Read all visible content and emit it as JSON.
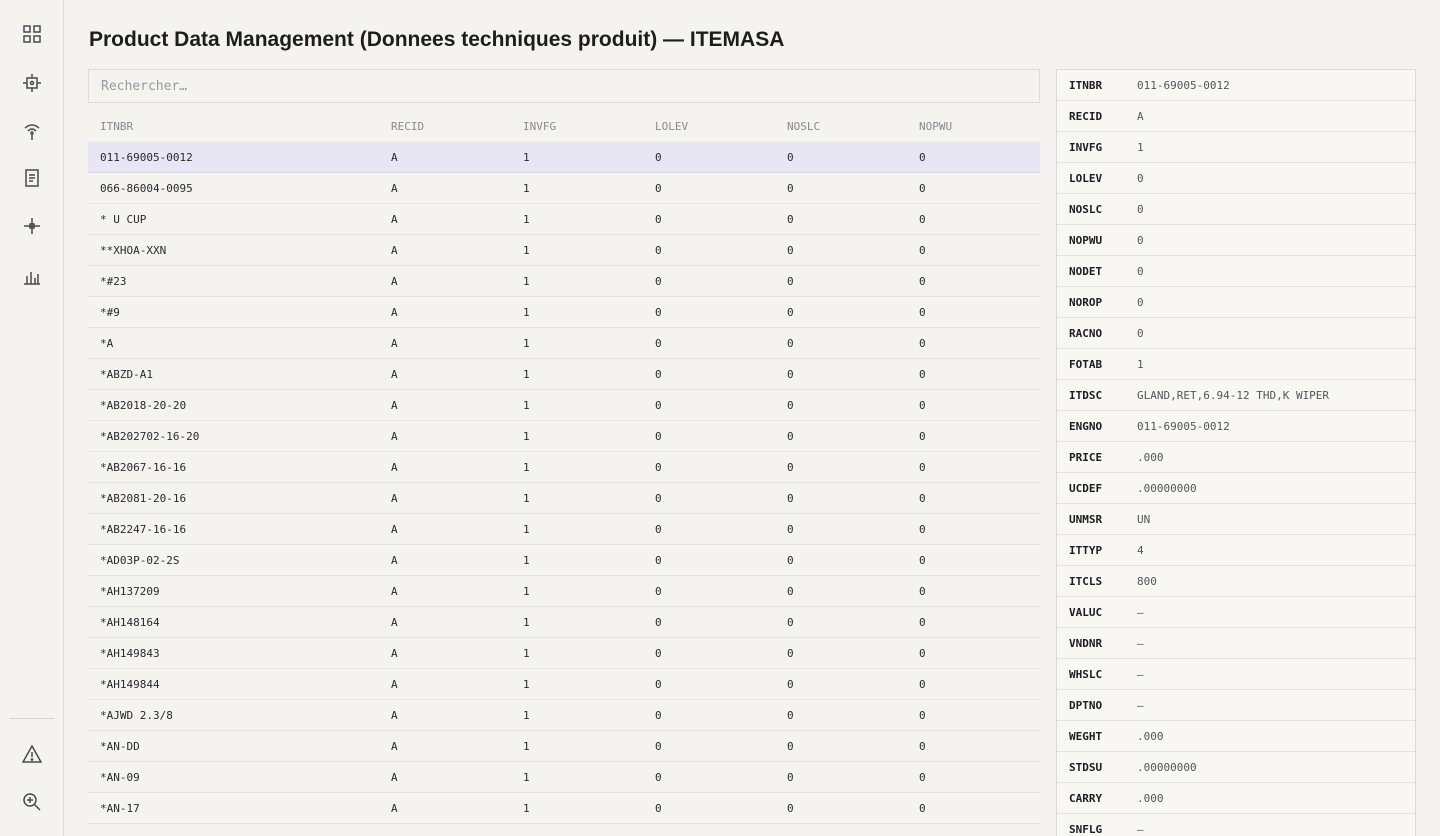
{
  "page": {
    "title": "Product Data Management (Donnees techniques produit) — ITEMASA"
  },
  "search": {
    "placeholder": "Rechercher…"
  },
  "sidebar": {
    "icons": [
      "grid-icon",
      "chip-icon",
      "antenna-icon",
      "document-icon",
      "crosshair-icon",
      "bar-chart-icon",
      "warning-icon",
      "zoom-icon"
    ]
  },
  "table": {
    "columns": [
      "ITNBR",
      "RECID",
      "INVFG",
      "LOLEV",
      "NOSLC",
      "NOPWU"
    ],
    "rows": [
      [
        "011-69005-0012",
        "A",
        "1",
        "0",
        "0",
        "0"
      ],
      [
        "066-86004-0095",
        "A",
        "1",
        "0",
        "0",
        "0"
      ],
      [
        "* U CUP",
        "A",
        "1",
        "0",
        "0",
        "0"
      ],
      [
        "**XHOA-XXN",
        "A",
        "1",
        "0",
        "0",
        "0"
      ],
      [
        "*#23",
        "A",
        "1",
        "0",
        "0",
        "0"
      ],
      [
        "*#9",
        "A",
        "1",
        "0",
        "0",
        "0"
      ],
      [
        "*A",
        "A",
        "1",
        "0",
        "0",
        "0"
      ],
      [
        "*ABZD-A1",
        "A",
        "1",
        "0",
        "0",
        "0"
      ],
      [
        "*AB2018-20-20",
        "A",
        "1",
        "0",
        "0",
        "0"
      ],
      [
        "*AB202702-16-20",
        "A",
        "1",
        "0",
        "0",
        "0"
      ],
      [
        "*AB2067-16-16",
        "A",
        "1",
        "0",
        "0",
        "0"
      ],
      [
        "*AB2081-20-16",
        "A",
        "1",
        "0",
        "0",
        "0"
      ],
      [
        "*AB2247-16-16",
        "A",
        "1",
        "0",
        "0",
        "0"
      ],
      [
        "*AD03P-02-2S",
        "A",
        "1",
        "0",
        "0",
        "0"
      ],
      [
        "*AH137209",
        "A",
        "1",
        "0",
        "0",
        "0"
      ],
      [
        "*AH148164",
        "A",
        "1",
        "0",
        "0",
        "0"
      ],
      [
        "*AH149843",
        "A",
        "1",
        "0",
        "0",
        "0"
      ],
      [
        "*AH149844",
        "A",
        "1",
        "0",
        "0",
        "0"
      ],
      [
        "*AJWD 2.3/8",
        "A",
        "1",
        "0",
        "0",
        "0"
      ],
      [
        "*AN-DD",
        "A",
        "1",
        "0",
        "0",
        "0"
      ],
      [
        "*AN-09",
        "A",
        "1",
        "0",
        "0",
        "0"
      ],
      [
        "*AN-17",
        "A",
        "1",
        "0",
        "0",
        "0"
      ]
    ]
  },
  "detail": {
    "fields": [
      [
        "ITNBR",
        "011-69005-0012"
      ],
      [
        "RECID",
        "A"
      ],
      [
        "INVFG",
        "1"
      ],
      [
        "LOLEV",
        "0"
      ],
      [
        "NOSLC",
        "0"
      ],
      [
        "NOPWU",
        "0"
      ],
      [
        "NODET",
        "0"
      ],
      [
        "NOROP",
        "0"
      ],
      [
        "RACNO",
        "0"
      ],
      [
        "FOTAB",
        "1"
      ],
      [
        "ITDSC",
        "GLAND,RET,6.94-12 THD,K WIPER"
      ],
      [
        "ENGNO",
        "011-69005-0012"
      ],
      [
        "PRICE",
        ".000"
      ],
      [
        "UCDEF",
        ".00000000"
      ],
      [
        "UNMSR",
        "UN"
      ],
      [
        "ITTYP",
        "4"
      ],
      [
        "ITCLS",
        "800"
      ],
      [
        "VALUC",
        "—"
      ],
      [
        "VNDNR",
        "—"
      ],
      [
        "WHSLC",
        "—"
      ],
      [
        "DPTNO",
        "—"
      ],
      [
        "WEGHT",
        ".000"
      ],
      [
        "STDSU",
        ".00000000"
      ],
      [
        "CARRY",
        ".000"
      ],
      [
        "SNFLG",
        "—"
      ]
    ]
  }
}
